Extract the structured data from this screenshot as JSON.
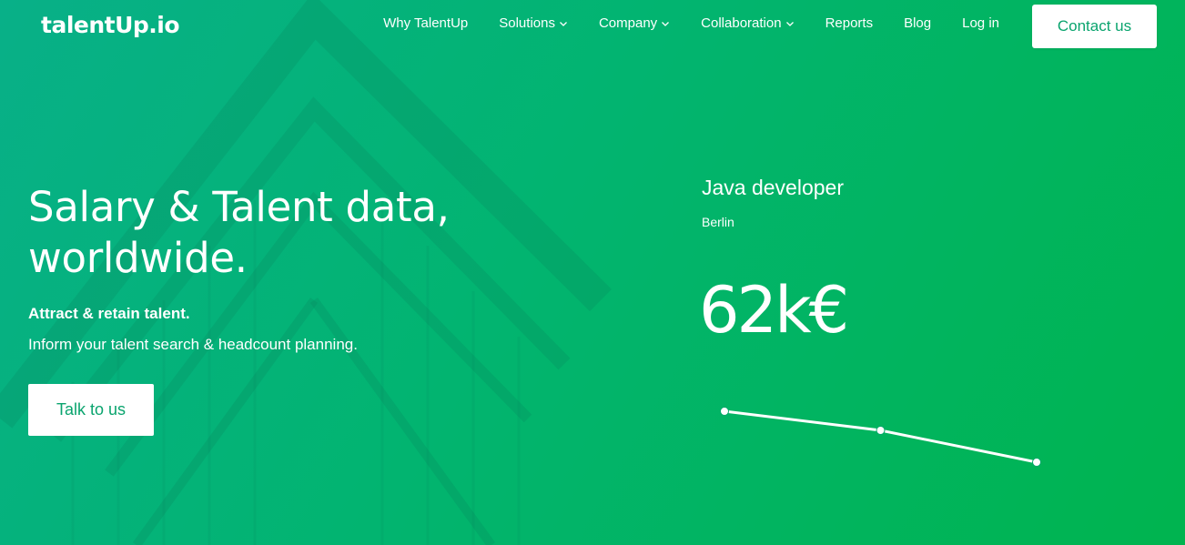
{
  "brand": {
    "logo_text": "talentUp.io"
  },
  "nav": {
    "items": [
      {
        "label": "Why TalentUp",
        "has_dropdown": false
      },
      {
        "label": "Solutions",
        "has_dropdown": true
      },
      {
        "label": "Company",
        "has_dropdown": true
      },
      {
        "label": "Collaboration",
        "has_dropdown": true
      },
      {
        "label": "Reports",
        "has_dropdown": false
      },
      {
        "label": "Blog",
        "has_dropdown": false
      },
      {
        "label": "Log in",
        "has_dropdown": false
      }
    ],
    "contact_label": "Contact us",
    "chevron_icon": "chevron-down-icon"
  },
  "hero": {
    "headline_line1": "Salary & Talent data,",
    "headline_line2": "worldwide.",
    "subhead": "Attract & retain talent.",
    "subtext": "Inform your talent search & headcount planning.",
    "cta_label": "Talk to us"
  },
  "salary_card": {
    "job_title": "Java developer",
    "city": "Berlin",
    "salary": "62k€",
    "trend_points": [
      100,
      88,
      68
    ]
  },
  "colors": {
    "gradient_start": "#08b088",
    "gradient_end": "#00b44f",
    "button_text": "#0aa46e",
    "white": "#ffffff"
  }
}
